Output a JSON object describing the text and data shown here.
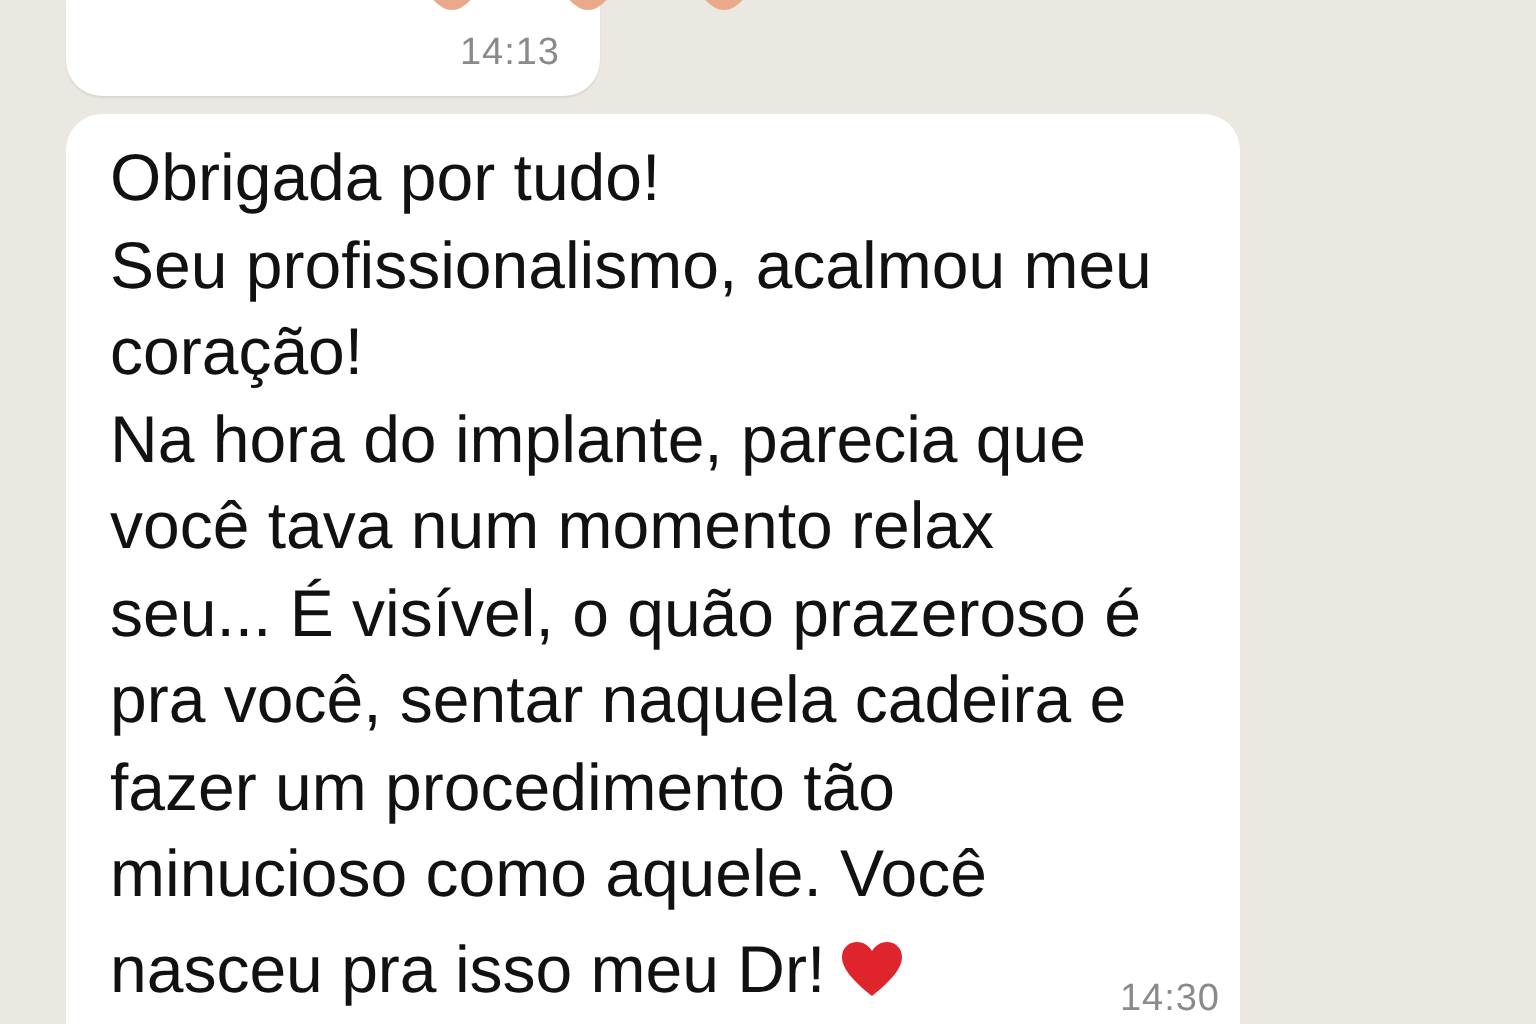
{
  "messages": [
    {
      "kind": "emoji",
      "time": "14:13"
    },
    {
      "kind": "text",
      "time": "14:30",
      "lines": [
        "Obrigada por tudo!",
        "Seu profissionalismo, acalmou meu",
        "coração!",
        "Na hora do implante, parecia que",
        "você tava num momento relax",
        "seu... É visível, o quão prazeroso é",
        "pra você, sentar naquela cadeira e",
        "fazer um procedimento tão",
        "minucioso como aquele.  Você",
        "nasceu pra isso meu Dr!"
      ],
      "heart": true
    }
  ]
}
